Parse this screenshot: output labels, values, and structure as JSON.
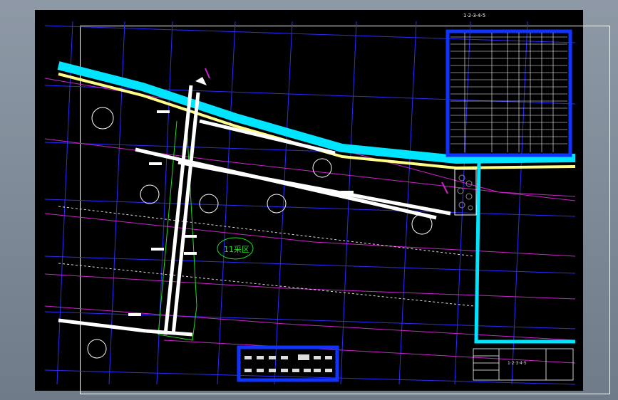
{
  "drawing": {
    "mining_area_label": "11采区",
    "sheet_number_label": "1·2·3·4·5",
    "title_block_text": "1·2·3·4·5"
  },
  "colors": {
    "background": "#000000",
    "grid_blue": "#2b2bff",
    "magenta": "#cc22cc",
    "cyan": "#00e5ff",
    "yellow": "#ffff88",
    "green": "#22dd22",
    "white": "#ffffff",
    "highlight_blue": "#1133ff"
  },
  "icons": [
    "legend-table-icon",
    "symbol-palette-icon",
    "equipment-symbol-icon",
    "north-arrow-icon"
  ]
}
